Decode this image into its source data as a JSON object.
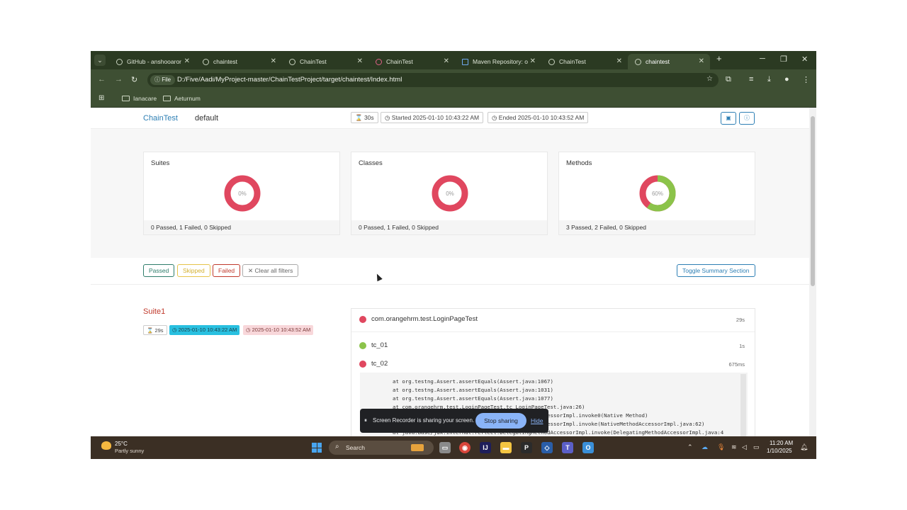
{
  "browser": {
    "tabs": [
      {
        "label": "GitHub - anshooaror",
        "active": false
      },
      {
        "label": "chaintest",
        "active": false
      },
      {
        "label": "ChainTest",
        "active": false
      },
      {
        "label": "ChainTest",
        "active": false
      },
      {
        "label": "Maven Repository: o",
        "active": false
      },
      {
        "label": "ChainTest",
        "active": false
      },
      {
        "label": "chaintest",
        "active": true
      }
    ],
    "new_tab": "+",
    "file_chip": "File",
    "url": "D:/Five/Aadi/MyProject-master/ChainTestProject/target/chaintest/Index.html",
    "bookmarks": [
      "Ianacare",
      "Aeturnum"
    ]
  },
  "header": {
    "brand": "ChainTest",
    "project": "default",
    "duration": "30s",
    "started": "Started 2025-01-10 10:43:22 AM",
    "ended": "Ended 2025-01-10 10:43:52 AM"
  },
  "summary": {
    "cards": [
      {
        "title": "Suites",
        "percent": "0%",
        "pass_fraction": 0.0,
        "footer": "0 Passed, 1 Failed, 0 Skipped"
      },
      {
        "title": "Classes",
        "percent": "0%",
        "pass_fraction": 0.0,
        "footer": "0 Passed, 1 Failed, 0 Skipped"
      },
      {
        "title": "Methods",
        "percent": "60%",
        "pass_fraction": 0.6,
        "footer": "3 Passed, 2 Failed, 0 Skipped"
      }
    ],
    "colors": {
      "pass": "#8bc34a",
      "fail": "#e0475f"
    }
  },
  "filters": {
    "passed": "Passed",
    "skipped": "Skipped",
    "failed": "Failed",
    "clear": "Clear all filters",
    "toggle": "Toggle Summary Section"
  },
  "suite": {
    "name": "Suite1",
    "duration": "29s",
    "start": "2025-01-10 10:43:22 AM",
    "end": "2025-01-10 10:43:52 AM"
  },
  "tests": {
    "class_name": "com.orangehrm.test.LoginPageTest",
    "class_duration": "29s",
    "methods": [
      {
        "name": "tc_01",
        "duration": "1s",
        "status": "pass"
      },
      {
        "name": "tc_02",
        "duration": "675ms",
        "status": "fail"
      }
    ],
    "trace": [
      "at org.testng.Assert.assertEquals(Assert.java:1067)",
      "at org.testng.Assert.assertEquals(Assert.java:1031)",
      "at org.testng.Assert.assertEquals(Assert.java:1077)",
      "at com.orangehrm.test.LoginPageTest.tc_LoginPageTest.java:26)",
      "at java.base/jdk.internal.reflect.NativeMethodAccessorImpl.invoke0(Native Method)",
      "at java.base/jdk.internal.reflect.NativeMethodAccessorImpl.invoke(NativeMethodAccessorImpl.java:62)",
      "at java.base/jdk.internal.reflect.DelegatingMethodAccessorImpl.invoke(DelegatingMethodAccessorImpl.java:4"
    ]
  },
  "recorder": {
    "message": "Screen Recorder is sharing your screen.",
    "stop": "Stop sharing",
    "hide": "Hide"
  },
  "taskbar": {
    "temperature": "25°C",
    "condition": "Partly sunny",
    "search": "Search",
    "time": "11:20 AM",
    "date": "1/10/2025"
  }
}
